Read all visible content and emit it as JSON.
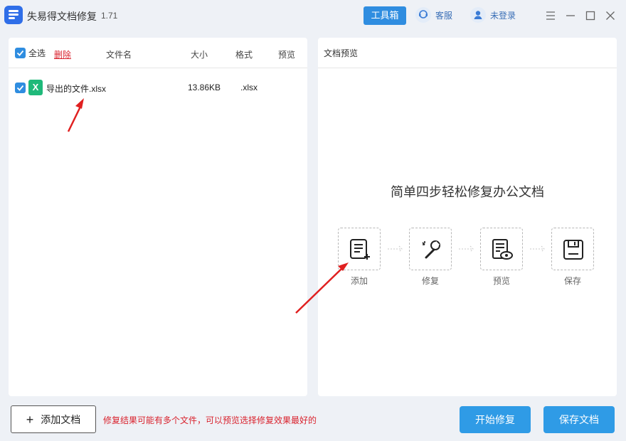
{
  "app": {
    "title": "失易得文档修复",
    "version": "1.71"
  },
  "header": {
    "toolbox_label": "工具箱",
    "service_label": "客服",
    "login_label": "未登录"
  },
  "file_list": {
    "select_all_label": "全选",
    "delete_label": "删除",
    "columns": [
      "文件名",
      "大小",
      "格式",
      "预览"
    ],
    "rows": [
      {
        "name": "导出的文件.xlsx",
        "size": "13.86KB",
        "format": ".xlsx",
        "checked": true
      }
    ]
  },
  "preview": {
    "title": "文档预览",
    "steps_title": "简单四步轻松修复办公文档",
    "steps": [
      {
        "label": "添加",
        "icon": "document-add-icon"
      },
      {
        "label": "修复",
        "icon": "wrench-icon"
      },
      {
        "label": "预览",
        "icon": "document-eye-icon"
      },
      {
        "label": "保存",
        "icon": "floppy-disk-icon"
      }
    ]
  },
  "footer": {
    "add_button": "添加文档",
    "hint": "修复结果可能有多个文件，可以预览选择修复效果最好的",
    "start_repair": "开始修复",
    "save_doc": "保存文档"
  },
  "colors": {
    "primary": "#2f8de0",
    "accent_red": "#d9232e",
    "excel_green": "#1fb97a"
  }
}
